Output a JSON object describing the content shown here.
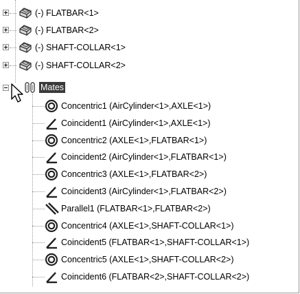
{
  "tree": {
    "parts": [
      {
        "label": "(-) FLATBAR<1>"
      },
      {
        "label": "(-) FLATBAR<2>"
      },
      {
        "label": "(-) SHAFT-COLLAR<1>"
      },
      {
        "label": "(-) SHAFT-COLLAR<2>"
      }
    ],
    "mates_folder": {
      "label": "Mates",
      "state": "expanded",
      "selected": true
    },
    "mates": [
      {
        "label": "Concentric1 (AirCylinder<1>,AXLE<1>)",
        "icon": "concentric-mate-icon"
      },
      {
        "label": "Coincident1 (AirCylinder<1>,AXLE<1>)",
        "icon": "coincident-mate-icon"
      },
      {
        "label": "Concentric2 (AXLE<1>,FLATBAR<1>)",
        "icon": "concentric-mate-icon"
      },
      {
        "label": "Coincident2 (AirCylinder<1>,FLATBAR<1>)",
        "icon": "coincident-mate-icon"
      },
      {
        "label": "Concentric3 (AXLE<1>,FLATBAR<2>)",
        "icon": "concentric-mate-icon"
      },
      {
        "label": "Coincident3 (AirCylinder<1>,FLATBAR<2>)",
        "icon": "coincident-mate-icon"
      },
      {
        "label": "Parallel1 (FLATBAR<1>,FLATBAR<2>)",
        "icon": "parallel-mate-icon"
      },
      {
        "label": "Concentric4 (AXLE<1>,SHAFT-COLLAR<1>)",
        "icon": "concentric-mate-icon"
      },
      {
        "label": "Coincident5 (FLATBAR<1>,SHAFT-COLLAR<1>)",
        "icon": "coincident-mate-icon"
      },
      {
        "label": "Concentric5 (AXLE<1>,SHAFT-COLLAR<2>)",
        "icon": "concentric-mate-icon"
      },
      {
        "label": "Coincident6 (FLATBAR<2>,SHAFT-COLLAR<2>)",
        "icon": "coincident-mate-icon"
      }
    ]
  }
}
